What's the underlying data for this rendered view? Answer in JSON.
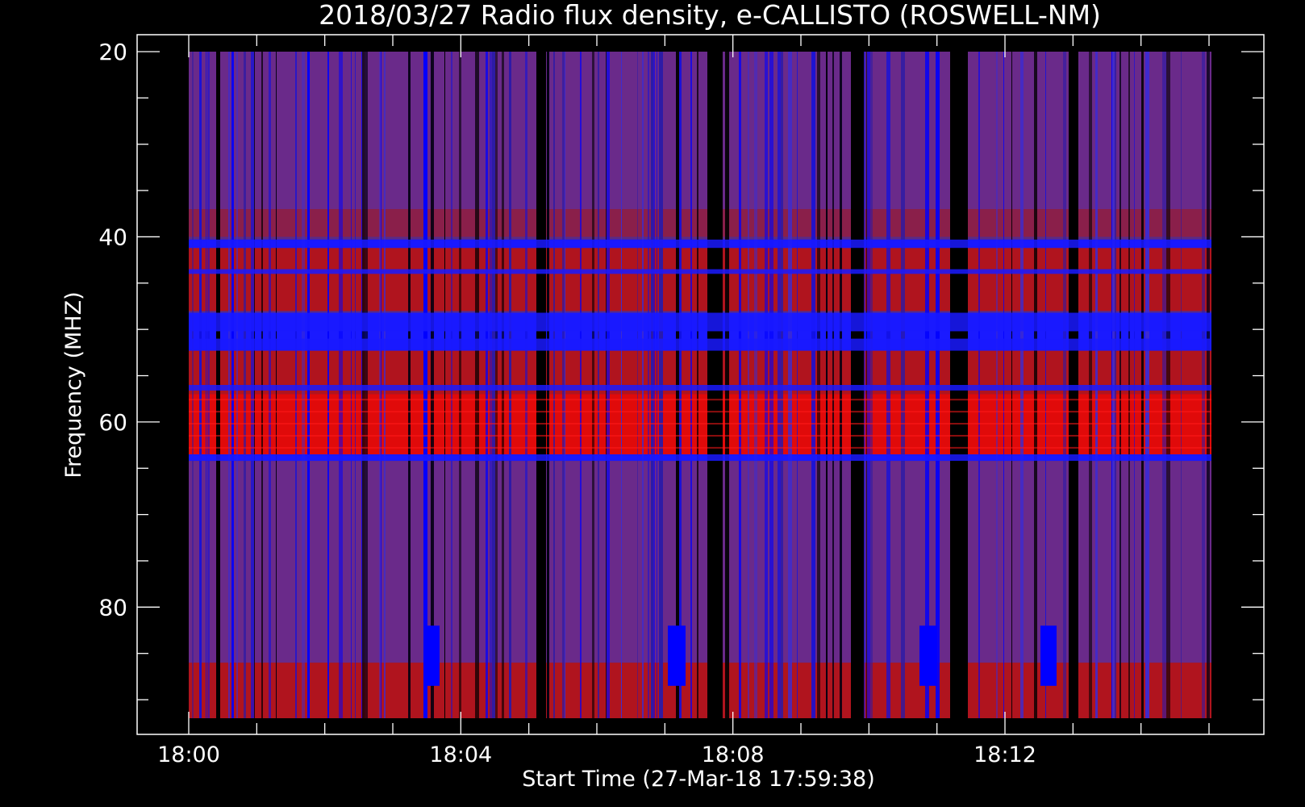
{
  "chart_data": {
    "type": "heatmap",
    "title": "2018/03/27  Radio flux density, e-CALLISTO (ROSWELL-NM)",
    "xlabel": "Start Time (27-Mar-18 17:59:38)",
    "ylabel": "Frequency (MHZ)",
    "x_range": [
      "18:00",
      "18:15"
    ],
    "y_range": [
      20,
      92
    ],
    "y_inverted": true,
    "x_ticks": [
      "18:00",
      "18:04",
      "18:08",
      "18:12"
    ],
    "y_ticks": [
      20,
      40,
      60,
      80
    ],
    "colormap": [
      "#000000",
      "#0000ff",
      "#6a1f8a",
      "#ff0000",
      "#ffff80"
    ],
    "horizontal_bands_mhz": [
      {
        "from": 20,
        "to": 37,
        "level": "purple"
      },
      {
        "from": 37,
        "to": 40,
        "level": "red-purple"
      },
      {
        "from": 40.3,
        "to": 41.2,
        "level": "blue"
      },
      {
        "from": 41.2,
        "to": 44,
        "level": "red"
      },
      {
        "from": 44,
        "to": 48,
        "level": "red"
      },
      {
        "from": 48.2,
        "to": 50.2,
        "level": "blue"
      },
      {
        "from": 50.2,
        "to": 52.3,
        "level": "blue"
      },
      {
        "from": 52.3,
        "to": 57,
        "level": "red"
      },
      {
        "from": 57,
        "to": 63.5,
        "level": "bright-red"
      },
      {
        "from": 63.5,
        "to": 64.2,
        "level": "blue"
      },
      {
        "from": 64.2,
        "to": 86,
        "level": "purple"
      },
      {
        "from": 86,
        "to": 92,
        "level": "red"
      }
    ]
  },
  "colors": {
    "background": "#000000",
    "foreground": "#ffffff"
  }
}
